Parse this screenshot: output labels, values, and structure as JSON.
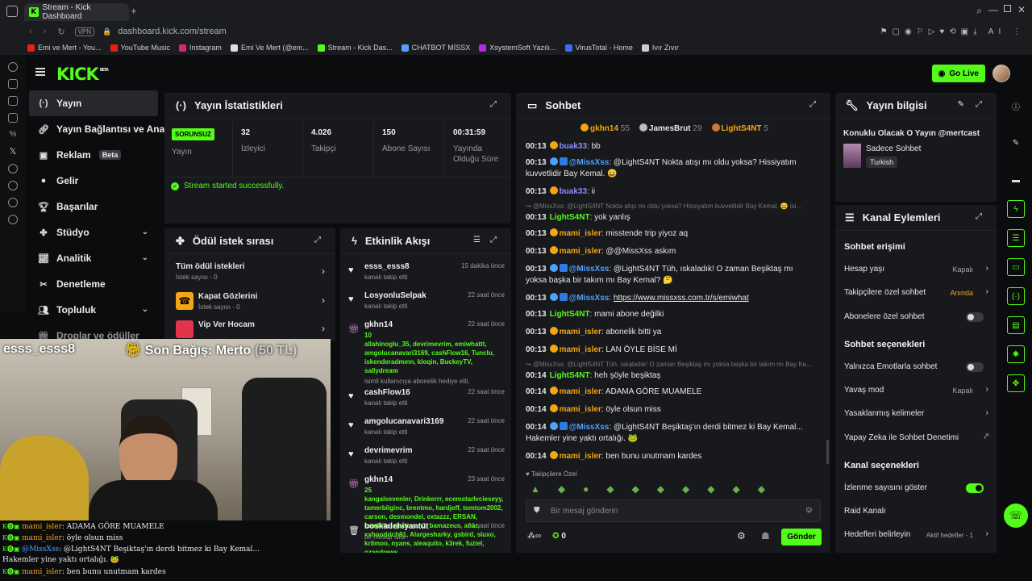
{
  "browser": {
    "tab_title": "Stream - Kick Dashboard",
    "url": "dashboard.kick.com/stream",
    "vpn": "VPN",
    "bookmarks": [
      "Emi ve Mert - You...",
      "YouTube Music",
      "Instagram",
      "Emi Ve Mert (@em...",
      "Stream - Kick Das...",
      "CHATBOT MİSSX",
      "XsystemSoft Yazılı...",
      "VirusTotal - Home",
      "Ivır Zıvır"
    ]
  },
  "header": {
    "logo": "KICK",
    "logo_sup": "BETA",
    "go_live": "Go Live"
  },
  "sidebar": {
    "items": [
      {
        "label": "Yayın"
      },
      {
        "label": "Yayın Bağlantısı ve Anahtarı"
      },
      {
        "label": "Reklam",
        "badge": "Beta"
      },
      {
        "label": "Gelir"
      },
      {
        "label": "Başarılar"
      },
      {
        "label": "Stüdyo"
      },
      {
        "label": "Analitik"
      },
      {
        "label": "Denetleme"
      },
      {
        "label": "Topluluk"
      },
      {
        "label": "Droplar ve ödüller"
      }
    ]
  },
  "stats": {
    "title": "Yayın İstatistikleri",
    "status_badge": "SORUNSUZ",
    "status_label": "Yayın",
    "items": [
      {
        "value": "32",
        "label": "İzleyici"
      },
      {
        "value": "4.026",
        "label": "Takipçi"
      },
      {
        "value": "150",
        "label": "Abone Sayısı"
      },
      {
        "value": "00:31:59",
        "label": "Yayında Olduğu Süre"
      }
    ],
    "success": "Stream started successfully."
  },
  "rewards": {
    "title": "Ödül istek sırası",
    "all": "Tüm ödül istekleri",
    "all_sub": "İstek sayısı - 0",
    "items": [
      {
        "name": "Kapat Gözlerini",
        "sub": "İstek sayısı - 0"
      },
      {
        "name": "Vip Ver Hocam",
        "sub": "İstek sayısı - 0"
      }
    ]
  },
  "events": {
    "title": "Etkinlik Akışı",
    "items": [
      {
        "name": "esss_esss8",
        "sub": "kanalı takip etti",
        "time": "15 dakika önce"
      },
      {
        "name": "LosyonluSelpak",
        "sub": "kanalı takip etti",
        "time": "22 saat önce"
      },
      {
        "name": "gkhn14",
        "count": "10",
        "gift": "allahinoglu_35, devrimevrim, emiwhattt, amgolucanavari3169, cashFlow16, Tunclu, iskenderadmınn, kloqin, BuckeyTV, sallydream",
        "sub": "isimli kullanıcıya abonelik hediye etti.",
        "time": "22 saat önce"
      },
      {
        "name": "cashFlow16",
        "sub": "kanalı takip etti",
        "time": "22 saat önce"
      },
      {
        "name": "amgolucanavari3169",
        "sub": "kanalı takip etti",
        "time": "22 saat önce"
      },
      {
        "name": "devrimevrim",
        "sub": "kanalı takip etti",
        "time": "22 saat önce"
      },
      {
        "name": "gkhn14",
        "count": "25",
        "gift": "kangalsevenler, Drinkerrr, ecemstarlvcieseyy, tamerbilginc, brentmo, hardjeff, tomtom2002, carson, desmondel, extazzz, ERSAN, cambills, rjackman3, bamazeus, anar, xxhoodrich91, Alargesharky, gsbird, sluxo, krilmoo, nyans, aleaquito, k3rek, fuziel, ozandrews",
        "time": "23 saat önce"
      },
      {
        "name": "boskadehiyantut",
        "sub": "bir mesajı sildi",
        "time": "21 saat önce"
      }
    ]
  },
  "chat": {
    "title": "Sohbet",
    "top": [
      {
        "name": "gkhn14",
        "count": "55"
      },
      {
        "name": "JamesBrut",
        "count": "29"
      },
      {
        "name": "LightS4NT",
        "count": "5"
      }
    ],
    "messages": [
      {
        "time": "00:13",
        "user": "buak33",
        "cls": "p",
        "text": "bb"
      },
      {
        "time": "00:13",
        "user": "@MissXss",
        "cls": "b",
        "text": "@LightS4NT Nokta atışı mı oldu yoksa? Hissiyatım kuvvetlidir Bay Kemal. 😄"
      },
      {
        "time": "00:13",
        "user": "buak33",
        "cls": "p",
        "text": "ii"
      },
      {
        "sys": "↪ @MissXss: @LightS4NT Nokta atışı mı oldu yoksa? Hissiyatım kuvvetlidir Bay Kemal. 😄 isi..."
      },
      {
        "time": "00:13",
        "user": "LightS4NT",
        "cls": "g",
        "text": "yok yanlış"
      },
      {
        "time": "00:13",
        "user": "mami_isler",
        "cls": "y",
        "text": "misstende trip yiyoz aq"
      },
      {
        "time": "00:13",
        "user": "mami_isler",
        "cls": "y",
        "text": "@@MissXss askım"
      },
      {
        "time": "00:13",
        "user": "@MissXss",
        "cls": "b",
        "text": "@LightS4NT Tüh, ıskaladık! O zaman Beşiktaş mı yoksa başka bir takım mı Bay Kemal? 🤔"
      },
      {
        "time": "00:13",
        "user": "@MissXss",
        "cls": "b",
        "text": "https://www.missxss.com.tr/s/emiwhat"
      },
      {
        "time": "00:13",
        "user": "LightS4NT",
        "cls": "g",
        "text": "mami abone değilki"
      },
      {
        "time": "00:13",
        "user": "mami_isler",
        "cls": "y",
        "text": "abonelik bitti ya"
      },
      {
        "time": "00:13",
        "user": "mami_isler",
        "cls": "y",
        "text": "LAN ÖYLE BİSE Mİ"
      },
      {
        "sys": "↪ @MissXss: @LightS4NT Tüh, ıskaladık! O zaman Beşiktaş mı yoksa başka bir takım mı Bay Ke..."
      },
      {
        "time": "00:14",
        "user": "LightS4NT",
        "cls": "g",
        "text": "heh şöyle beşiktaş"
      },
      {
        "time": "00:14",
        "user": "mami_isler",
        "cls": "y",
        "text": "ADAMA GÖRE MUAMELE"
      },
      {
        "time": "00:14",
        "user": "mami_isler",
        "cls": "y",
        "text": "öyle olsun miss"
      },
      {
        "time": "00:14",
        "user": "@MissXss",
        "cls": "b",
        "text": "@LightS4NT Beşiktaş'ın derdi bitmez ki Bay Kemal... Hakemler yine yaktı ortalığı. 🐸"
      },
      {
        "time": "00:14",
        "user": "mami_isler",
        "cls": "y",
        "text": "ben bunu unutmam kardes"
      }
    ],
    "followers_only": "Takipçilere Özel",
    "input_placeholder": "Bir mesaj gönderin",
    "count": "0",
    "send": "Gönder"
  },
  "info": {
    "title": "Yayın bilgisi",
    "stream_title": "Konuklu Olacak O Yayın @mertcast",
    "category": "Sadece Sohbet",
    "language": "Turkish"
  },
  "actions": {
    "title": "Kanal Eylemleri",
    "chat_access": "Sohbet erişimi",
    "rows1": [
      {
        "label": "Hesap yaşı",
        "value": "Kapalı"
      },
      {
        "label": "Takipçilere özel sohbet",
        "value": "Anında"
      },
      {
        "label": "Abonelere özel sohbet"
      }
    ],
    "chat_options": "Sohbet seçenekleri",
    "rows2": [
      {
        "label": "Yalnızca Emotlarla sohbet"
      },
      {
        "label": "Yavaş mod",
        "value": "Kapalı"
      },
      {
        "label": "Yasaklanmış kelimeler"
      },
      {
        "label": "Yapay Zeka ile Sohbet Denetimi"
      }
    ],
    "channel_options": "Kanal seçenekleri",
    "rows3": [
      {
        "label": "İzlenme sayısını göster"
      },
      {
        "label": "Raid Kanalı"
      },
      {
        "label": "Hedefleri belirleyin",
        "value": "Aktif hedefler - 1"
      }
    ]
  },
  "stream": {
    "streamer": "esss_esss8",
    "donation": "Son Bağış: Merto",
    "amount": "(50 TL)",
    "overlay_chat": [
      {
        "user": "mami_isler",
        "text": ": ADAMA GÖRE MUAMELE"
      },
      {
        "user": "mami_isler",
        "text": ": öyle olsun miss"
      },
      {
        "user": "@MissXss",
        "text": ": @LightS4NT Beşiktaş'ın derdi bitmez ki Bay Kemal..."
      },
      {
        "user": "",
        "text": "Hakemler yine yaktı ortalığı. 🐸"
      },
      {
        "user": "mami_isler",
        "text": ": ben bunu unutmam kardes"
      }
    ]
  }
}
